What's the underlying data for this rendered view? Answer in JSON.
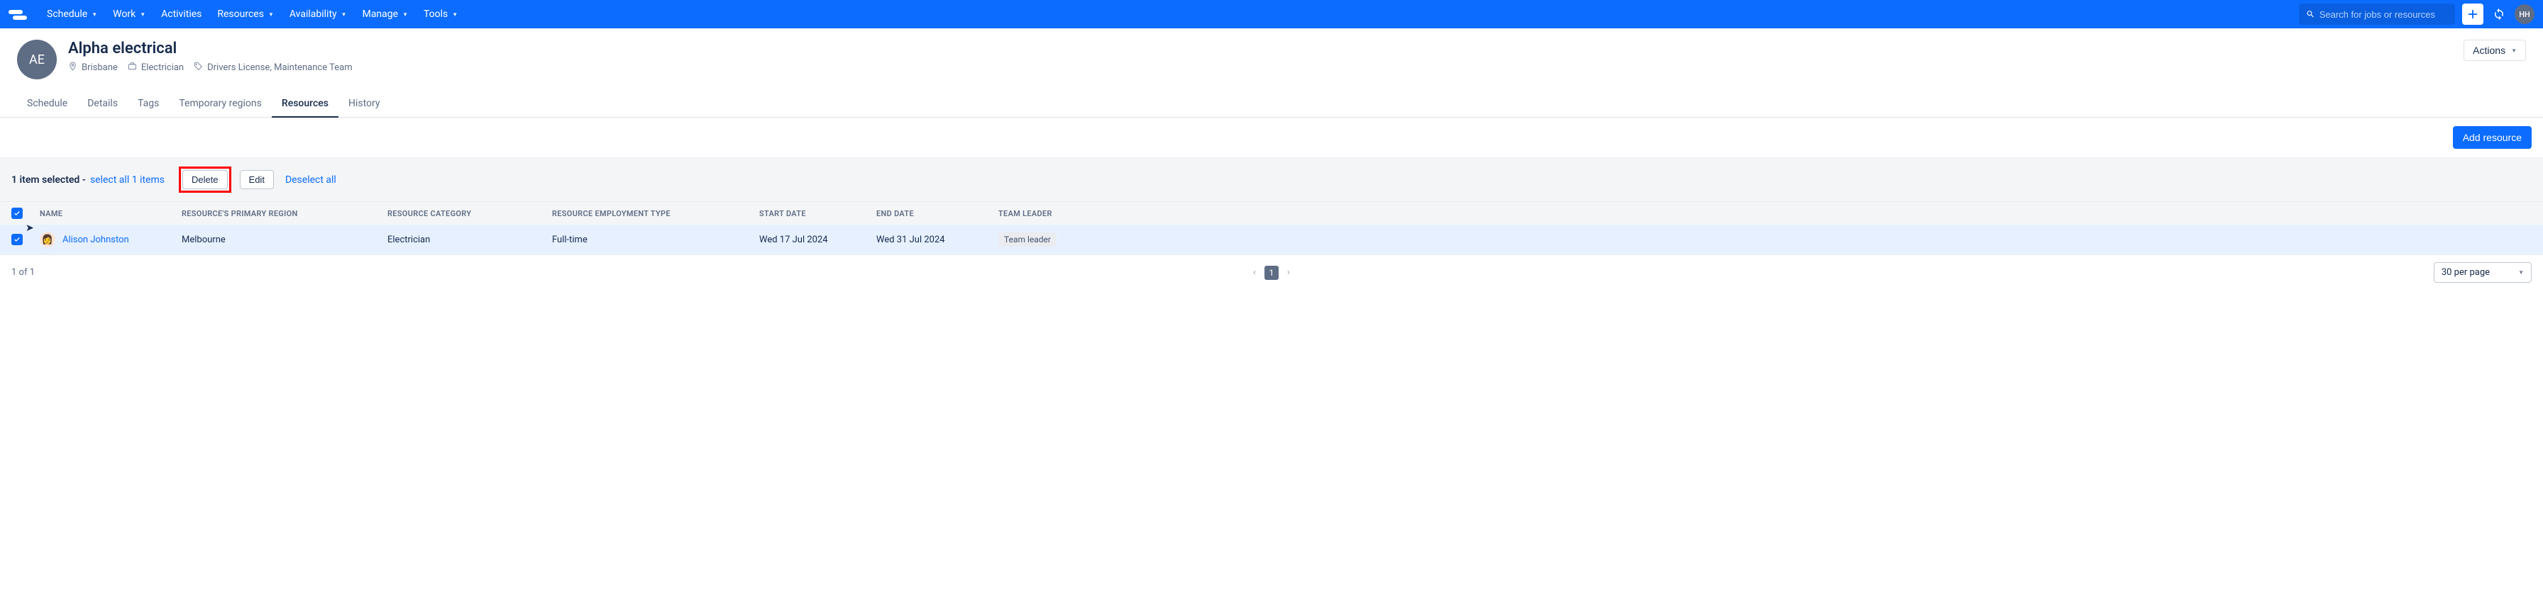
{
  "nav": {
    "items": [
      "Schedule",
      "Work",
      "Activities",
      "Resources",
      "Availability",
      "Manage",
      "Tools"
    ],
    "search_placeholder": "Search for jobs or resources",
    "user_initials": "HH"
  },
  "header": {
    "avatar_initials": "AE",
    "title": "Alpha electrical",
    "location": "Brisbane",
    "role": "Electrician",
    "tags": "Drivers License, Maintenance Team",
    "actions_label": "Actions"
  },
  "tabs": [
    "Schedule",
    "Details",
    "Tags",
    "Temporary regions",
    "Resources",
    "History"
  ],
  "active_tab": "Resources",
  "add_button": "Add resource",
  "selection": {
    "text": "1 item selected - ",
    "select_all": "select all 1 items",
    "delete": "Delete",
    "edit": "Edit",
    "deselect": "Deselect all"
  },
  "table": {
    "headers": {
      "name": "Name",
      "region": "Resource's Primary Region",
      "category": "Resource Category",
      "employment": "Resource Employment Type",
      "start": "Start Date",
      "end": "End Date",
      "leader": "Team Leader"
    },
    "rows": [
      {
        "name": "Alison Johnston",
        "avatar_emoji": "👩",
        "region": "Melbourne",
        "category": "Electrician",
        "employment": "Full-time",
        "start": "Wed 17 Jul 2024",
        "end": "Wed 31 Jul 2024",
        "leader": "Team leader"
      }
    ]
  },
  "pagination": {
    "info": "1 of 1",
    "current": "1",
    "per_page": "30 per page"
  }
}
